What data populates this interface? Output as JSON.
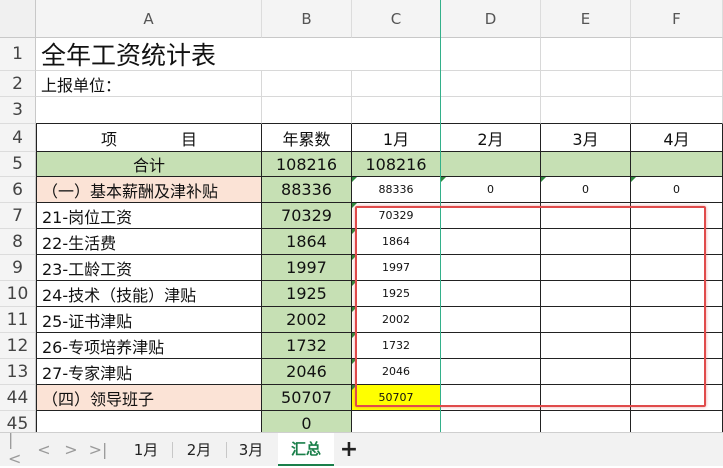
{
  "columns": [
    "A",
    "B",
    "C",
    "D",
    "E",
    "F"
  ],
  "rows": [
    {
      "num": "1",
      "a": "全年工资统计表",
      "b": "",
      "c": "",
      "d": "",
      "e": "",
      "f": ""
    },
    {
      "num": "2",
      "a": "上报单位：",
      "b": "",
      "c": "",
      "d": "",
      "e": "",
      "f": ""
    },
    {
      "num": "3",
      "a": "",
      "b": "",
      "c": "",
      "d": "",
      "e": "",
      "f": ""
    },
    {
      "num": "4",
      "a": "项　　　　目",
      "b": "年累数",
      "c": "1月",
      "d": "2月",
      "e": "3月",
      "f": "4月"
    },
    {
      "num": "5",
      "a": "合计",
      "b": "108216",
      "c": "108216",
      "d": "",
      "e": "",
      "f": ""
    },
    {
      "num": "6",
      "a": "（一）基本薪酬及津补贴",
      "b": "88336",
      "c": "88336",
      "d": "0",
      "e": "0",
      "f": "0"
    },
    {
      "num": "7",
      "a": "21-岗位工资",
      "b": "70329",
      "c": "70329",
      "d": "",
      "e": "",
      "f": ""
    },
    {
      "num": "8",
      "a": "22-生活费",
      "b": "1864",
      "c": "1864",
      "d": "",
      "e": "",
      "f": ""
    },
    {
      "num": "9",
      "a": "23-工龄工资",
      "b": "1997",
      "c": "1997",
      "d": "",
      "e": "",
      "f": ""
    },
    {
      "num": "10",
      "a": "24-技术（技能）津贴",
      "b": "1925",
      "c": "1925",
      "d": "",
      "e": "",
      "f": ""
    },
    {
      "num": "11",
      "a": "25-证书津贴",
      "b": "2002",
      "c": "2002",
      "d": "",
      "e": "",
      "f": ""
    },
    {
      "num": "12",
      "a": "26-专项培养津贴",
      "b": "1732",
      "c": "1732",
      "d": "",
      "e": "",
      "f": ""
    },
    {
      "num": "13",
      "a": "27-专家津贴",
      "b": "2046",
      "c": "2046",
      "d": "",
      "e": "",
      "f": ""
    },
    {
      "num": "44",
      "a": "（四）领导班子",
      "b": "50707",
      "c": "50707",
      "d": "",
      "e": "",
      "f": ""
    },
    {
      "num": "45",
      "a": "",
      "b": "0",
      "c": "",
      "d": "",
      "e": "",
      "f": ""
    }
  ],
  "sheet_tabs": [
    "1月",
    "2月",
    "3月",
    "汇总"
  ],
  "active_tab": "汇总",
  "add_tab": "+",
  "nav": {
    "first": "|<",
    "prev": "<",
    "next": ">",
    "last": ">|"
  },
  "colors": {
    "green": "#c6e0b4",
    "peach": "#fbe3d6",
    "yellow": "#ffff00",
    "annotation": "#e04b4b"
  }
}
